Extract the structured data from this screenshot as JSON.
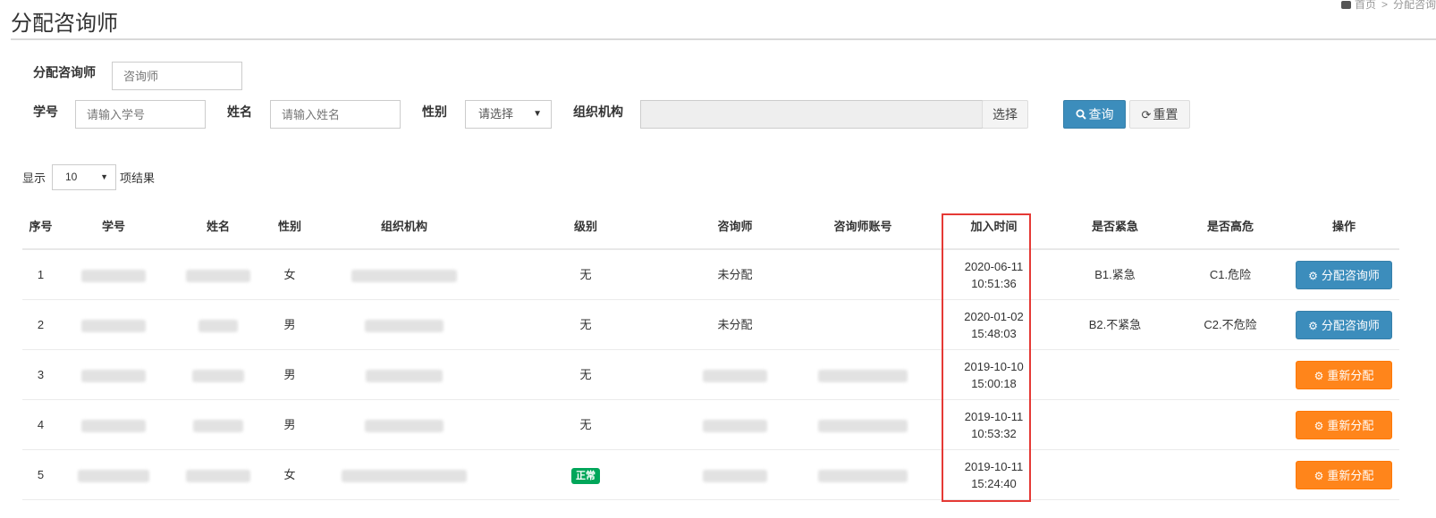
{
  "page": {
    "title": "分配咨询师"
  },
  "breadcrumb": {
    "home": "首页",
    "separator": ">",
    "current": "分配咨询"
  },
  "form": {
    "counselor_label": "分配咨询师",
    "counselor_placeholder": "咨询师",
    "student_id_label": "学号",
    "student_id_placeholder": "请输入学号",
    "name_label": "姓名",
    "name_placeholder": "请输入姓名",
    "gender_label": "性别",
    "gender_value": "请选择",
    "org_label": "组织机构",
    "org_value": "",
    "select_button": "选择",
    "query_button": "查询",
    "reset_button": "重置"
  },
  "length": {
    "prefix": "显示",
    "value": "10",
    "suffix": "项结果"
  },
  "table": {
    "headers": {
      "index": "序号",
      "student_id": "学号",
      "name": "姓名",
      "gender": "性别",
      "org": "组织机构",
      "level": "级别",
      "counselor": "咨询师",
      "counselor_account": "咨询师账号",
      "join_time": "加入时间",
      "urgent": "是否紧急",
      "high_risk": "是否高危",
      "action": "操作"
    },
    "rows": [
      {
        "index": "1",
        "gender": "女",
        "level": "无",
        "level_badge": false,
        "counselor": "未分配",
        "date": "2020-06-11",
        "time": "10:51:36",
        "urgent": "B1.紧急",
        "risk": "C1.危险",
        "action": "分配咨询师",
        "action_style": "blue"
      },
      {
        "index": "2",
        "gender": "男",
        "level": "无",
        "level_badge": false,
        "counselor": "未分配",
        "date": "2020-01-02",
        "time": "15:48:03",
        "urgent": "B2.不紧急",
        "risk": "C2.不危险",
        "action": "分配咨询师",
        "action_style": "blue"
      },
      {
        "index": "3",
        "gender": "男",
        "level": "无",
        "level_badge": false,
        "counselor": "",
        "date": "2019-10-10",
        "time": "15:00:18",
        "urgent": "",
        "risk": "",
        "action": "重新分配",
        "action_style": "orange"
      },
      {
        "index": "4",
        "gender": "男",
        "level": "无",
        "level_badge": false,
        "counselor": "",
        "date": "2019-10-11",
        "time": "10:53:32",
        "urgent": "",
        "risk": "",
        "action": "重新分配",
        "action_style": "orange"
      },
      {
        "index": "5",
        "gender": "女",
        "level": "正常",
        "level_badge": true,
        "counselor": "",
        "date": "2019-10-11",
        "time": "15:24:40",
        "urgent": "",
        "risk": "",
        "action": "重新分配",
        "action_style": "orange"
      }
    ]
  },
  "colors": {
    "primary": "#3c8dbc",
    "warning": "#ff851b",
    "success": "#00a65a",
    "highlight": "#e53935"
  }
}
